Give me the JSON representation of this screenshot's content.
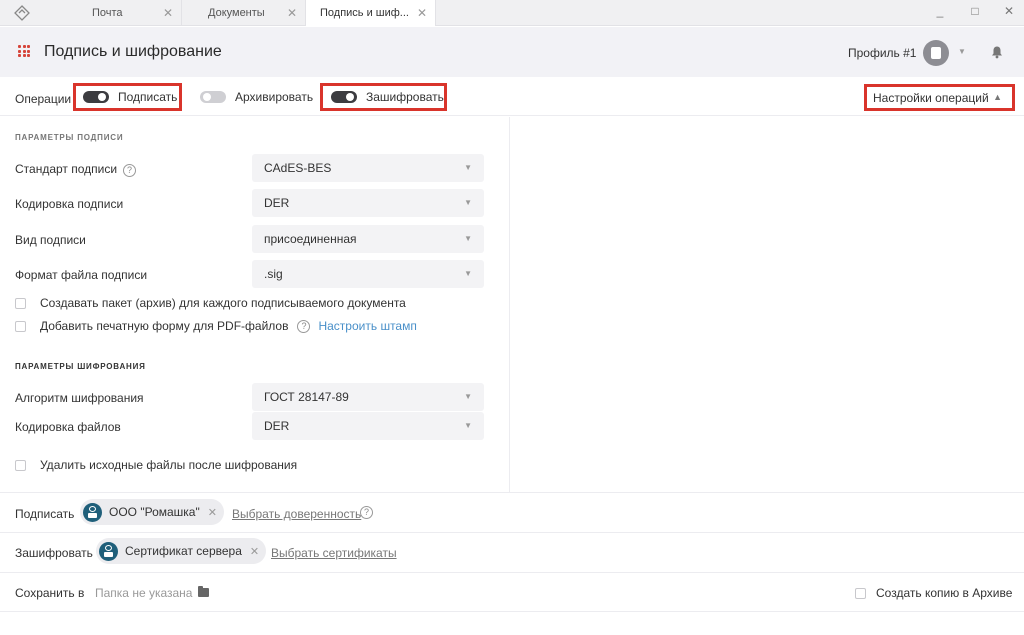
{
  "tabs": [
    {
      "label": "Почта"
    },
    {
      "label": "Документы"
    },
    {
      "label": "Подпись и шиф..."
    }
  ],
  "header": {
    "title": "Подпись и шифрование",
    "profile": "Профиль #1"
  },
  "operations": {
    "label": "Операции",
    "sign": {
      "label": "Подписать",
      "enabled": true
    },
    "archive": {
      "label": "Архивировать",
      "enabled": false
    },
    "encrypt": {
      "label": "Зашифровать",
      "enabled": true
    },
    "settings_label": "Настройки операций"
  },
  "signature_params": {
    "section_title": "ПАРАМЕТРЫ ПОДПИСИ",
    "standard_label": "Стандарт подписи",
    "standard_value": "CAdES-BES",
    "encoding_label": "Кодировка подписи",
    "encoding_value": "DER",
    "type_label": "Вид подписи",
    "type_value": "присоединенная",
    "format_label": "Формат файла подписи",
    "format_value": ".sig",
    "create_package_label": "Создавать пакет (архив) для каждого подписываемого документа",
    "print_form_label": "Добавить печатную форму для PDF-файлов",
    "stamp_link": "Настроить штамп"
  },
  "encryption_params": {
    "section_title": "ПАРАМЕТРЫ ШИФРОВАНИЯ",
    "algorithm_label": "Алгоритм шифрования",
    "algorithm_value": "ГОСТ 28147-89",
    "encoding_label": "Кодировка файлов",
    "encoding_value": "DER",
    "delete_source_label": "Удалить исходные файлы после шифрования"
  },
  "bottom": {
    "sign_label": "Подписать",
    "sign_chip": "ООО \"Ромашка\"",
    "proxy_link": "Выбрать доверенность",
    "encrypt_label": "Зашифровать",
    "encrypt_chip": "Сертификат сервера",
    "cert_link": "Выбрать сертификаты",
    "save_label": "Сохранить в",
    "folder_placeholder": "Папка не указана",
    "archive_copy_label": "Создать копию в Архиве"
  },
  "colors": {
    "accent_red": "#d9342b",
    "chip_icon": "#1f5f7a",
    "link": "#4a90c9"
  }
}
